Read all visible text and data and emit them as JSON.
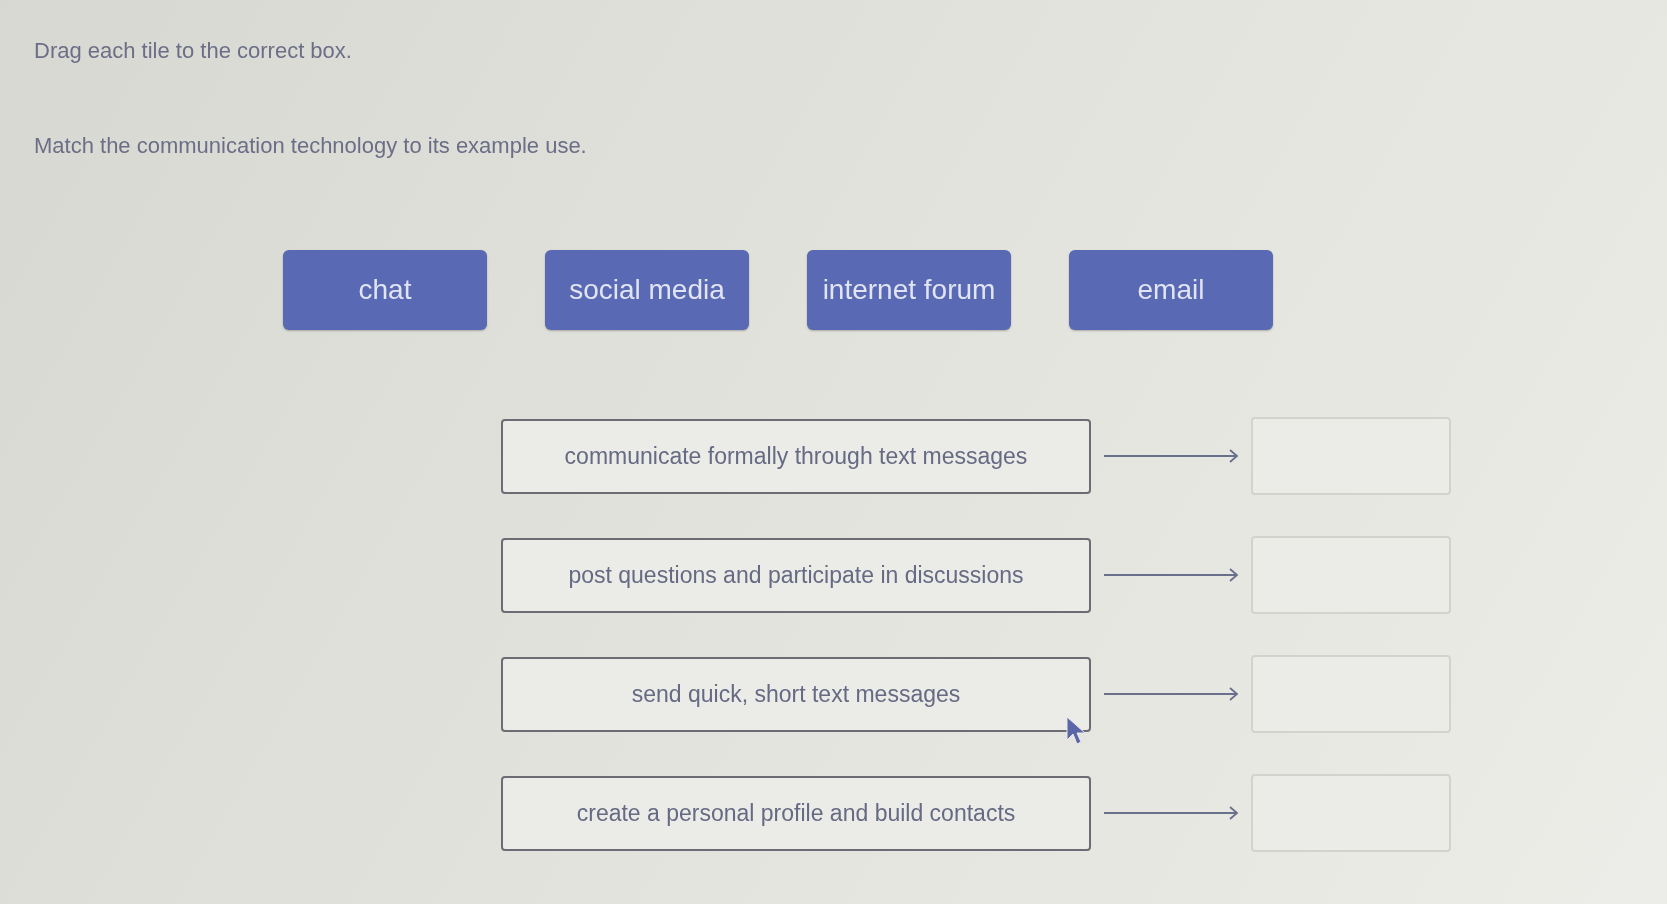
{
  "instruction": "Drag each tile to the correct box.",
  "prompt": "Match the communication technology to its example use.",
  "tiles": [
    {
      "label": "chat"
    },
    {
      "label": "social media"
    },
    {
      "label": "internet forum"
    },
    {
      "label": "email"
    }
  ],
  "pairs": [
    {
      "description": "communicate formally through text messages"
    },
    {
      "description": "post questions and participate in discussions"
    },
    {
      "description": "send quick, short text messages"
    },
    {
      "description": "create a personal profile and build contacts"
    }
  ]
}
